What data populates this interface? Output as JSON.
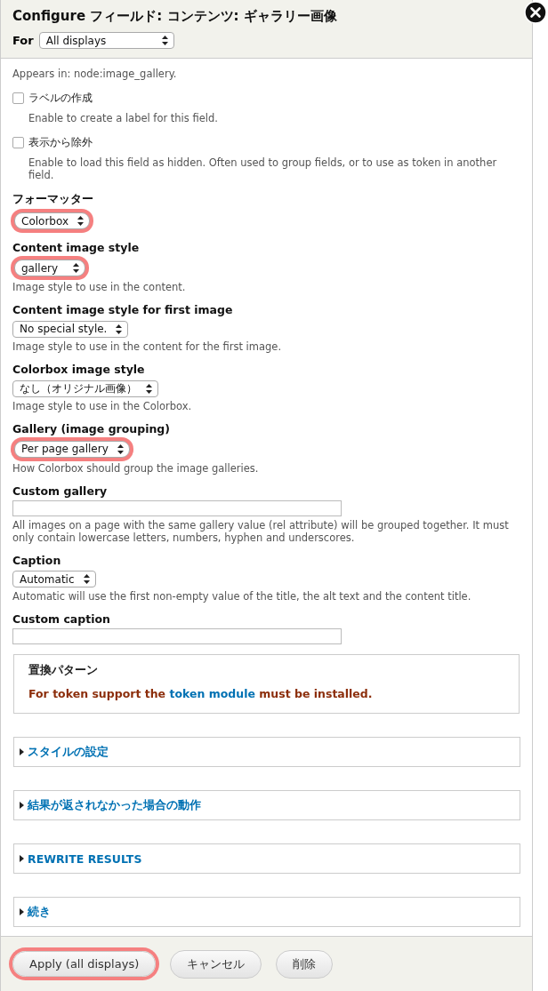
{
  "dialog": {
    "title": "Configure フィールド: コンテンツ: ギャラリー画像",
    "for_label": "For",
    "for_select": {
      "value": "All displays"
    }
  },
  "appears_in": "Appears in: node:image_gallery.",
  "checkboxes": [
    {
      "label": "ラベルの作成",
      "description": "Enable to create a label for this field.",
      "checked": false
    },
    {
      "label": "表示から除外",
      "description": "Enable to load this field as hidden. Often used to group fields, or to use as token in another field.",
      "checked": false
    }
  ],
  "fields": [
    {
      "kind": "select",
      "label": "フォーマッター",
      "value": "Colorbox",
      "highlighted": true
    },
    {
      "kind": "select",
      "label": "Content image style",
      "value": "gallery",
      "highlighted": true,
      "description": "Image style to use in the content."
    },
    {
      "kind": "select",
      "label": "Content image style for first image",
      "value": "No special style.",
      "highlighted": false,
      "description": "Image style to use in the content for the first image."
    },
    {
      "kind": "select",
      "label": "Colorbox image style",
      "value": "なし（オリジナル画像）",
      "highlighted": false,
      "description": "Image style to use in the Colorbox."
    },
    {
      "kind": "select",
      "label": "Gallery (image grouping)",
      "value": "Per page gallery",
      "highlighted": true,
      "description": "How Colorbox should group the image galleries."
    },
    {
      "kind": "text",
      "label": "Custom gallery",
      "description": "All images on a page with the same gallery value (rel attribute) will be grouped together. It must only contain lowercase letters, numbers, hyphen and underscores."
    },
    {
      "kind": "select",
      "label": "Caption",
      "value": "Automatic",
      "highlighted": false,
      "description": "Automatic will use the first non-empty value of the title, the alt text and the content title."
    },
    {
      "kind": "text",
      "label": "Custom caption"
    }
  ],
  "token_box": {
    "title": "置換パターン",
    "message_before": "For token support the",
    "link": "token module",
    "message_after": "must be installed."
  },
  "collapsibles": [
    {
      "label": "スタイルの設定",
      "expanded": false
    },
    {
      "label": "結果が返されなかった場合の動作",
      "expanded": false
    },
    {
      "label": "REWRITE RESULTS",
      "expanded": false
    },
    {
      "label": "続き",
      "expanded": false
    }
  ],
  "buttons": [
    {
      "label": "Apply (all displays)",
      "highlighted": true
    },
    {
      "label": "キャンセル",
      "highlighted": false
    },
    {
      "label": "削除",
      "highlighted": false
    }
  ]
}
